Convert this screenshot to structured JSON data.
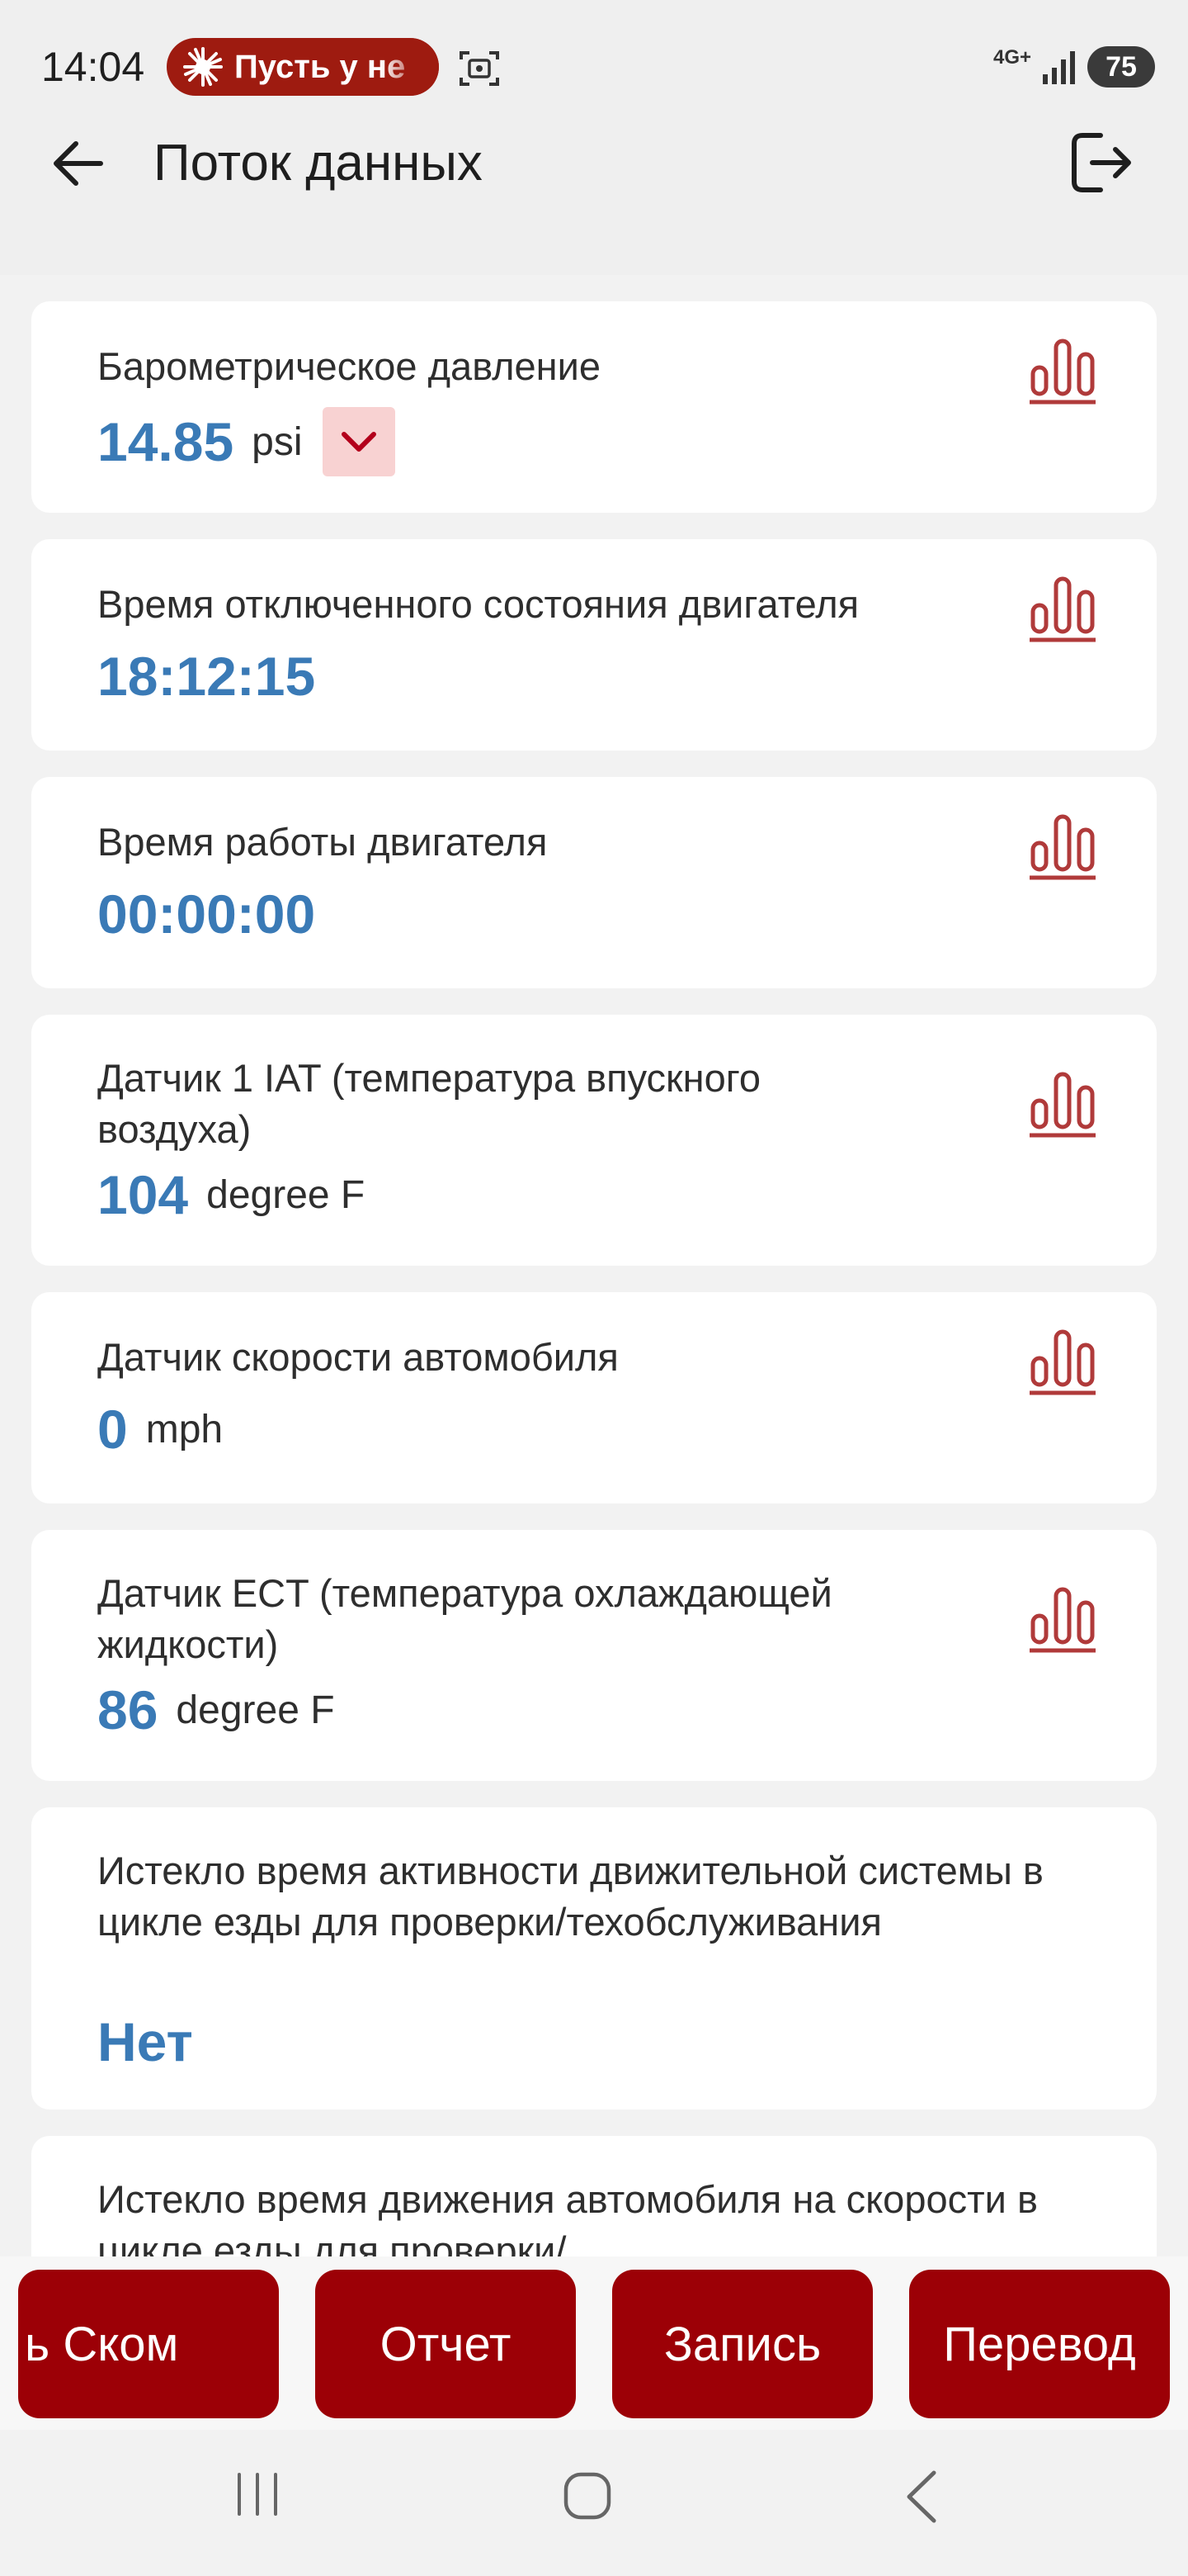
{
  "status_bar": {
    "time": "14:04",
    "notification_text": "Пусть у не",
    "network": "4G+",
    "battery": "75"
  },
  "app_bar": {
    "title": "Поток данных"
  },
  "cards": [
    {
      "label": "Барометрическое давление",
      "value": "14.85",
      "unit": "psi",
      "has_dropdown": true
    },
    {
      "label": "Время отключенного состояния двигателя",
      "value": "18:12:15",
      "unit": ""
    },
    {
      "label": "Время работы двигателя",
      "value": "00:00:00",
      "unit": ""
    },
    {
      "label": "Датчик 1 IAT (температура впускного воздуха)",
      "value": "104",
      "unit": "degree F"
    },
    {
      "label": "Датчик скорости автомобиля",
      "value": "0",
      "unit": "mph"
    },
    {
      "label": "Датчик ECT (температура охлаждающей жидкости)",
      "value": "86",
      "unit": "degree F"
    },
    {
      "label": "Истекло время активности движительной системы в цикле езды для проверки/техобслуживания",
      "value": "Нет",
      "unit": ""
    },
    {
      "label": "Истекло время движения автомобиля на скорости в цикле езды для проверки/",
      "value": "",
      "unit": ""
    }
  ],
  "bottom_buttons": {
    "btn1": "ь     Ском",
    "btn2": "Отчет",
    "btn3": "Запись",
    "btn4": "Перевод"
  },
  "colors": {
    "accent": "#9c0006",
    "value_blue": "#3a7ab6",
    "chart_icon": "#b03a3a",
    "dropdown_bg": "#f8d2d2"
  }
}
